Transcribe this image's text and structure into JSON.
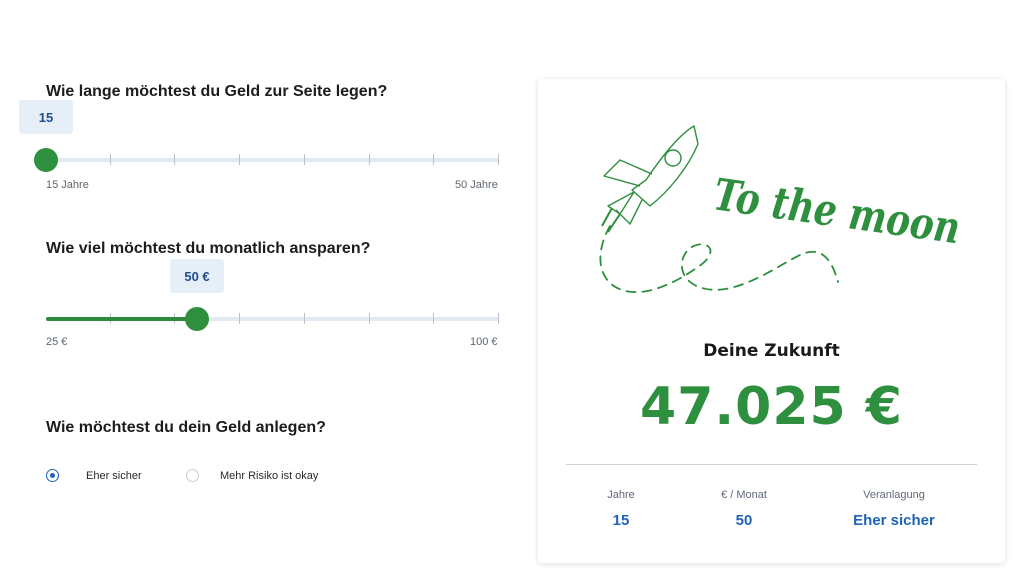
{
  "duration": {
    "question": "Wie lange möchtest du Geld zur Seite legen?",
    "value_label": "15",
    "min_label": "15 Jahre",
    "max_label": "50 Jahre",
    "level": 0
  },
  "monthly": {
    "question": "Wie viel möchtest du monatlich ansparen?",
    "value_label": "50 €",
    "min_label": "25 €",
    "max_label": "100 €",
    "level": 0.333
  },
  "investment": {
    "question": "Wie möchtest du dein Geld anlegen?",
    "options": [
      {
        "label": "Eher sicher",
        "selected": true
      },
      {
        "label": "Mehr Risiko ist okay",
        "selected": false
      }
    ]
  },
  "result": {
    "slogan": "To the moon",
    "subtitle": "Deine Zukunft",
    "amount": "47.025 €",
    "summary": [
      {
        "label": "Jahre",
        "value": "15"
      },
      {
        "label": "€ / Monat",
        "value": "50"
      },
      {
        "label": "Veranlagung",
        "value": "Eher sicher"
      }
    ]
  },
  "colors": {
    "accent_green": "#2e8f3e",
    "accent_blue": "#1f63b5",
    "bubble_bg": "#e6eef8"
  }
}
